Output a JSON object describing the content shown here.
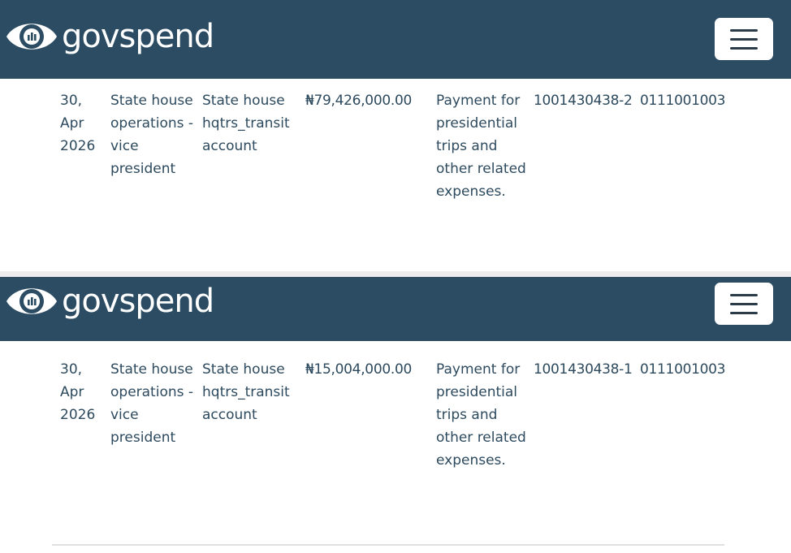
{
  "brand": {
    "name": "govspend",
    "logo_icon": "eye-chart-icon",
    "nav_color": "#2b4c63"
  },
  "menu": {
    "icon": "hamburger-menu-icon"
  },
  "records": [
    {
      "date": "30, Apr 2026",
      "organization": "State house operations - vice president",
      "account": "State house hqtrs_transit account",
      "amount": "₦79,426,000.00",
      "description": "Payment for presidential trips and other related expenses.",
      "reference": "1001430438-2",
      "code": "0111001003"
    },
    {
      "date": "30, Apr 2026",
      "organization": "State house operations - vice president",
      "account": "State house hqtrs_transit account",
      "amount": "₦15,004,000.00",
      "description": "Payment for presidential trips and other related expenses.",
      "reference": "1001430438-1",
      "code": "0111001003"
    }
  ]
}
